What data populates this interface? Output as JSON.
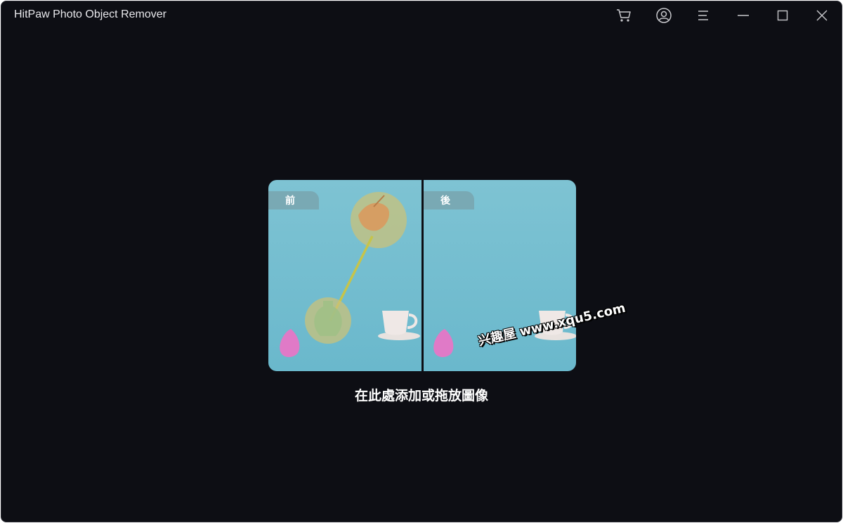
{
  "titlebar": {
    "app_title": "HitPaw Photo Object Remover",
    "icons": [
      "cart-icon",
      "account-icon",
      "menu-icon",
      "minimize-icon",
      "maximize-icon",
      "close-icon"
    ]
  },
  "dropzone": {
    "before_label": "前",
    "after_label": "後",
    "instruction": "在此處添加或拖放圖像"
  },
  "watermark": {
    "text": "兴趣屋 www.xqu5.com"
  },
  "colors": {
    "window_bg": "#0d0e14",
    "photo_bg": "#86c8d6",
    "highlight": "#c9c27a"
  }
}
